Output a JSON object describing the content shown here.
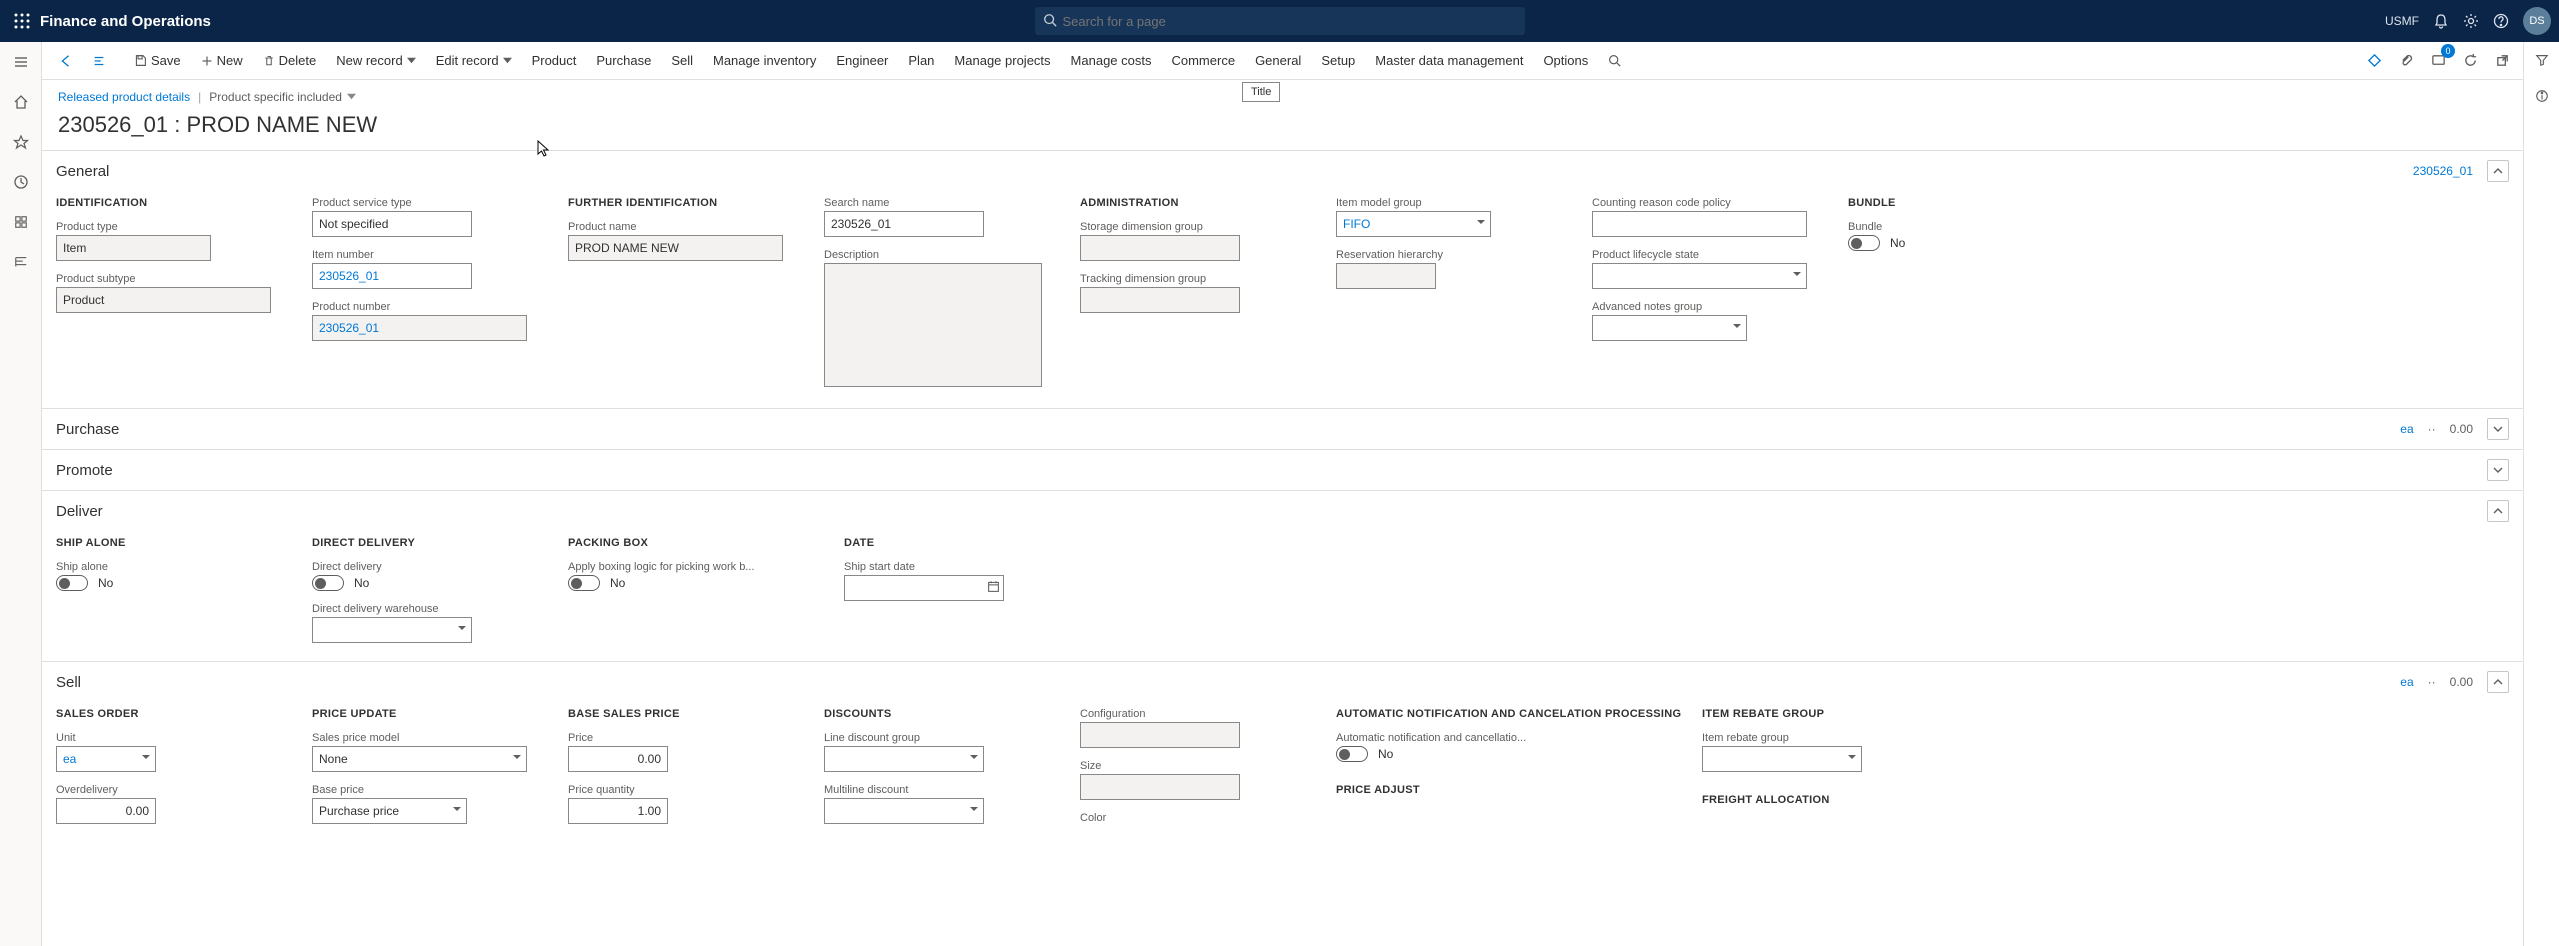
{
  "app_title": "Finance and Operations",
  "search_placeholder": "Search for a page",
  "legal_entity": "USMF",
  "avatar": "DS",
  "toolbar": {
    "back": "Back",
    "edit_pane": "Edit",
    "save": "Save",
    "new": "New",
    "delete": "Delete",
    "new_record": "New record",
    "edit_record": "Edit record",
    "tabs": [
      "Product",
      "Purchase",
      "Sell",
      "Manage inventory",
      "Engineer",
      "Plan",
      "Manage projects",
      "Manage costs",
      "Commerce",
      "General",
      "Setup",
      "Master data management",
      "Options"
    ],
    "badge0": "0"
  },
  "breadcrumb": {
    "link": "Released product details",
    "view": "Product specific included"
  },
  "page_title": "230526_01 : PROD NAME NEW",
  "title_tooltip": "Title",
  "sections": {
    "general": {
      "title": "General",
      "summary": "230526_01",
      "identification_hdr": "IDENTIFICATION",
      "product_type_lbl": "Product type",
      "product_type_val": "Item",
      "product_subtype_lbl": "Product subtype",
      "product_subtype_val": "Product",
      "product_service_type_lbl": "Product service type",
      "product_service_type_val": "Not specified",
      "item_number_lbl": "Item number",
      "item_number_val": "230526_01",
      "product_number_lbl": "Product number",
      "product_number_val": "230526_01",
      "further_id_hdr": "FURTHER IDENTIFICATION",
      "product_name_lbl": "Product name",
      "product_name_val": "PROD NAME NEW",
      "search_name_lbl": "Search name",
      "search_name_val": "230526_01",
      "description_lbl": "Description",
      "admin_hdr": "ADMINISTRATION",
      "storage_dim_lbl": "Storage dimension group",
      "tracking_dim_lbl": "Tracking dimension group",
      "item_model_lbl": "Item model group",
      "item_model_val": "FIFO",
      "reservation_lbl": "Reservation hierarchy",
      "counting_reason_lbl": "Counting reason code policy",
      "lifecycle_lbl": "Product lifecycle state",
      "adv_notes_lbl": "Advanced notes group",
      "bundle_hdr": "BUNDLE",
      "bundle_lbl": "Bundle",
      "bundle_val": "No"
    },
    "purchase": {
      "title": "Purchase",
      "summary_unit": "ea",
      "summary_sep": "··",
      "summary_val": "0.00"
    },
    "promote": {
      "title": "Promote"
    },
    "deliver": {
      "title": "Deliver",
      "ship_alone_hdr": "SHIP ALONE",
      "ship_alone_lbl": "Ship alone",
      "ship_alone_val": "No",
      "direct_delivery_hdr": "DIRECT DELIVERY",
      "direct_delivery_lbl": "Direct delivery",
      "direct_delivery_val": "No",
      "dd_warehouse_lbl": "Direct delivery warehouse",
      "packing_hdr": "PACKING BOX",
      "packing_lbl": "Apply boxing logic for picking work b...",
      "packing_val": "No",
      "date_hdr": "DATE",
      "ship_date_lbl": "Ship start date"
    },
    "sell": {
      "title": "Sell",
      "summary_unit": "ea",
      "summary_sep": "··",
      "summary_val": "0.00",
      "sales_order_hdr": "SALES ORDER",
      "unit_lbl": "Unit",
      "unit_val": "ea",
      "overdelivery_lbl": "Overdelivery",
      "overdelivery_val": "0.00",
      "price_update_hdr": "PRICE UPDATE",
      "sales_price_model_lbl": "Sales price model",
      "sales_price_model_val": "None",
      "base_price_lbl": "Base price",
      "base_price_val": "Purchase price",
      "base_sales_price_hdr": "BASE SALES PRICE",
      "price_lbl": "Price",
      "price_val": "0.00",
      "price_qty_lbl": "Price quantity",
      "price_qty_val": "1.00",
      "discounts_hdr": "DISCOUNTS",
      "line_disc_lbl": "Line discount group",
      "multiline_disc_lbl": "Multiline discount",
      "config_lbl": "Configuration",
      "size_lbl": "Size",
      "color_lbl": "Color",
      "auto_hdr": "AUTOMATIC NOTIFICATION AND CANCELATION PROCESSING",
      "auto_lbl": "Automatic notification and cancellatio...",
      "auto_val": "No",
      "price_adjust_hdr": "PRICE ADJUST",
      "rebate_hdr": "ITEM REBATE GROUP",
      "rebate_lbl": "Item rebate group",
      "freight_hdr": "FREIGHT ALLOCATION"
    }
  }
}
